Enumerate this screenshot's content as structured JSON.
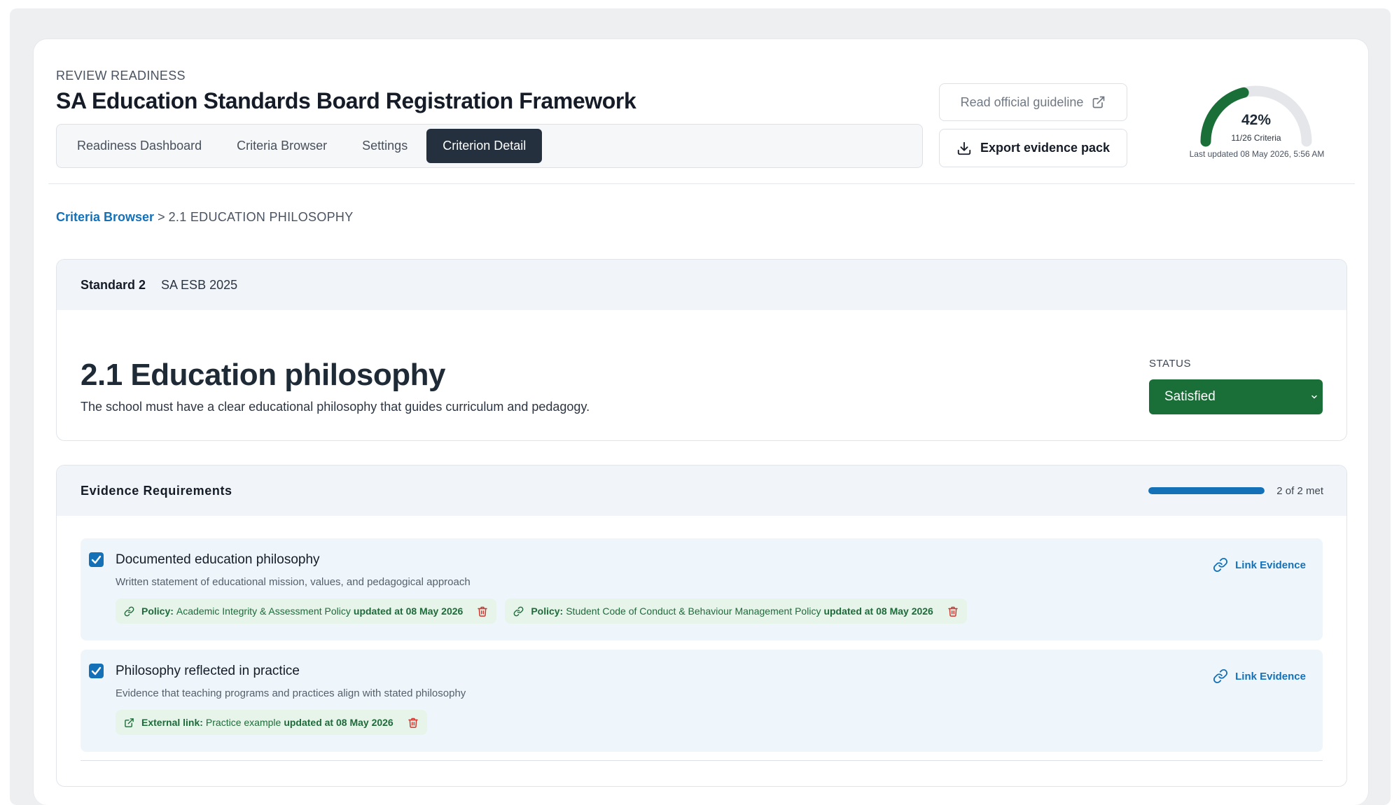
{
  "header": {
    "eyebrow": "REVIEW READINESS",
    "title": "SA Education Standards Board Registration Framework"
  },
  "tabs": [
    {
      "label": "Readiness Dashboard",
      "active": false
    },
    {
      "label": "Criteria Browser",
      "active": false
    },
    {
      "label": "Settings",
      "active": false
    },
    {
      "label": "Criterion Detail",
      "active": true
    }
  ],
  "actions": {
    "guideline_label": "Read official guideline",
    "export_label": "Export evidence pack"
  },
  "progress": {
    "percent_label": "42%",
    "fraction": 0.42,
    "criteria_label": "11/26 Criteria",
    "last_updated": "Last updated 08 May 2026, 5:56 AM"
  },
  "breadcrumb": {
    "parent": "Criteria Browser",
    "separator": ">",
    "current": "2.1 Education philosophy"
  },
  "criterion": {
    "standard": "Standard 2",
    "framework": "SA ESB 2025",
    "title": "2.1 Education philosophy",
    "description": "The school must have a clear educational philosophy that guides curriculum and pedagogy.",
    "status_label": "STATUS",
    "status_value": "Satisfied"
  },
  "evidence": {
    "title": "Evidence Requirements",
    "met_fraction": 1.0,
    "met_label": "2 of 2 met",
    "link_label": "Link Evidence",
    "requirements": [
      {
        "title": "Documented education philosophy",
        "description": "Written statement of educational mission, values, and pedagogical approach",
        "items": [
          {
            "type": "Policy:",
            "name": "Academic Integrity & Assessment Policy",
            "updated": "updated at 08 May 2026",
            "icon": "link-icon"
          },
          {
            "type": "Policy:",
            "name": "Student Code of Conduct & Behaviour Management Policy",
            "updated": "updated at 08 May 2026",
            "icon": "link-icon"
          }
        ]
      },
      {
        "title": "Philosophy reflected in practice",
        "description": "Evidence that teaching programs and practices align with stated philosophy",
        "items": [
          {
            "type": "External link:",
            "name": "Practice example",
            "updated": "updated at 08 May 2026",
            "icon": "external-link-icon"
          }
        ]
      }
    ]
  },
  "colors": {
    "accent": "#1471b8",
    "dark": "#25303f",
    "success": "#1a6e37",
    "danger": "#d0342c"
  }
}
